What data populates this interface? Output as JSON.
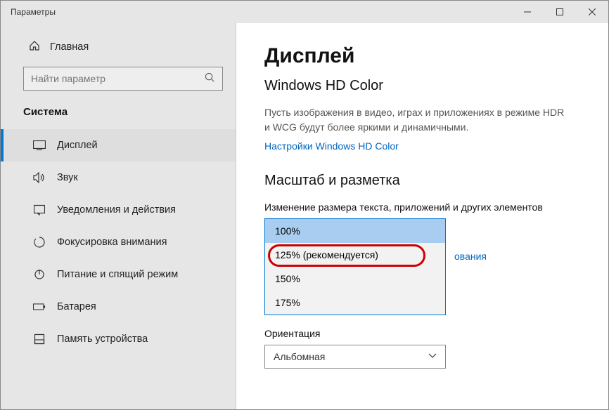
{
  "window": {
    "title": "Параметры"
  },
  "home": {
    "label": "Главная"
  },
  "search": {
    "placeholder": "Найти параметр"
  },
  "category": "Система",
  "nav": [
    {
      "label": "Дисплей"
    },
    {
      "label": "Звук"
    },
    {
      "label": "Уведомления и действия"
    },
    {
      "label": "Фокусировка внимания"
    },
    {
      "label": "Питание и спящий режим"
    },
    {
      "label": "Батарея"
    },
    {
      "label": "Память устройства"
    }
  ],
  "page": {
    "title": "Дисплей",
    "hdcolor": {
      "heading": "Windows HD Color",
      "desc": "Пусть изображения в видео, играх и приложениях в режиме HDR и WCG будут более яркими и динамичными.",
      "link": "Настройки Windows HD Color"
    },
    "scale": {
      "heading": "Масштаб и разметка",
      "label": "Изменение размера текста, приложений и других элементов",
      "options": [
        "100%",
        "125% (рекомендуется)",
        "150%",
        "175%"
      ],
      "behind_link": "ования"
    },
    "orientation": {
      "label": "Ориентация",
      "value": "Альбомная"
    }
  }
}
